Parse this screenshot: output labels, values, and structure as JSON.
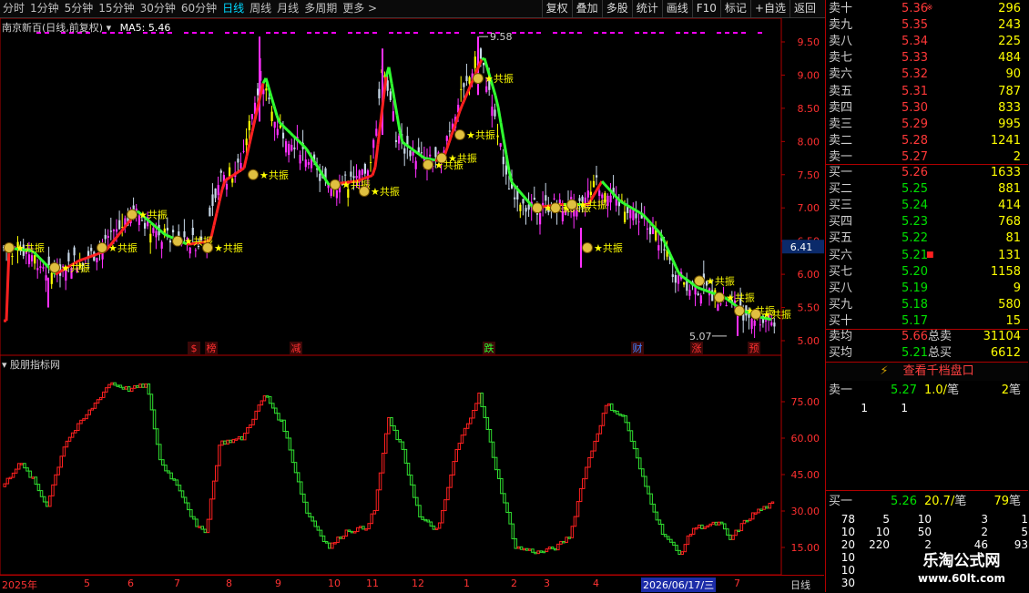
{
  "toolbar": {
    "periods": [
      "分时",
      "1分钟",
      "5分钟",
      "15分钟",
      "30分钟",
      "60分钟",
      "日线",
      "周线",
      "月线",
      "多周期",
      "更多 >"
    ],
    "active_period": "日线",
    "actions": [
      "复权",
      "叠加",
      "多股",
      "统计",
      "画线",
      "F10",
      "标记",
      "+自选",
      "返回"
    ]
  },
  "chart": {
    "title": "南京新百(日线,前复权)",
    "ma_label": "MA5: 5.46",
    "price_axis": [
      "9.50",
      "9.00",
      "8.50",
      "8.00",
      "7.50",
      "7.00",
      "6.50",
      "6.00",
      "5.50",
      "5.00"
    ],
    "current_price_tag": "6.41",
    "high_label": "9.58",
    "low_label": "5.07",
    "signal_label": "共振",
    "event_markers": [
      "$",
      "榜",
      "减",
      "跌",
      "财",
      "涨",
      "预"
    ],
    "indicator_title": "股朋指标网",
    "indicator_axis": [
      "75.00",
      "60.00",
      "45.00",
      "30.00",
      "15.00"
    ],
    "x_labels": [
      "2025年",
      "5",
      "6",
      "7",
      "8",
      "9",
      "10",
      "11",
      "12",
      "1",
      "2",
      "3",
      "4",
      "2026/06/17/三",
      "7"
    ],
    "period_label": "日线"
  },
  "quote": {
    "sell": [
      {
        "label": "卖十",
        "price": "5.36",
        "vol": "296",
        "mark": "※"
      },
      {
        "label": "卖九",
        "price": "5.35",
        "vol": "243",
        "mark": ""
      },
      {
        "label": "卖八",
        "price": "5.34",
        "vol": "225",
        "mark": ""
      },
      {
        "label": "卖七",
        "price": "5.33",
        "vol": "484",
        "mark": ""
      },
      {
        "label": "卖六",
        "price": "5.32",
        "vol": "90",
        "mark": ""
      },
      {
        "label": "卖五",
        "price": "5.31",
        "vol": "787",
        "mark": ""
      },
      {
        "label": "卖四",
        "price": "5.30",
        "vol": "833",
        "mark": ""
      },
      {
        "label": "卖三",
        "price": "5.29",
        "vol": "995",
        "mark": ""
      },
      {
        "label": "卖二",
        "price": "5.28",
        "vol": "1241",
        "mark": ""
      },
      {
        "label": "卖一",
        "price": "5.27",
        "vol": "2",
        "mark": ""
      }
    ],
    "buy": [
      {
        "label": "买一",
        "price": "5.26",
        "vol": "1633",
        "mark": ""
      },
      {
        "label": "买二",
        "price": "5.25",
        "vol": "881",
        "mark": ""
      },
      {
        "label": "买三",
        "price": "5.24",
        "vol": "414",
        "mark": ""
      },
      {
        "label": "买四",
        "price": "5.23",
        "vol": "768",
        "mark": ""
      },
      {
        "label": "买五",
        "price": "5.22",
        "vol": "81",
        "mark": ""
      },
      {
        "label": "买六",
        "price": "5.21",
        "vol": "131",
        "mark": "■"
      },
      {
        "label": "买七",
        "price": "5.20",
        "vol": "1158",
        "mark": ""
      },
      {
        "label": "买八",
        "price": "5.19",
        "vol": "9",
        "mark": ""
      },
      {
        "label": "买九",
        "price": "5.18",
        "vol": "580",
        "mark": ""
      },
      {
        "label": "买十",
        "price": "5.17",
        "vol": "15",
        "mark": ""
      }
    ],
    "avg_sell": {
      "label": "卖均",
      "price": "5.66",
      "label2": "总卖",
      "vol": "31104"
    },
    "avg_buy": {
      "label": "买均",
      "price": "5.21",
      "label2": "总买",
      "vol": "6612"
    },
    "detail_button": "查看千档盘口",
    "ask1": {
      "label": "卖一",
      "price": "5.27",
      "amount": "1.0/",
      "unit": "笔",
      "count": "2",
      "unit2": "笔"
    },
    "ask1_queue": [
      "1",
      "1"
    ],
    "bid1": {
      "label": "买一",
      "price": "5.26",
      "amount": "20.7/",
      "unit": "笔",
      "count": "79",
      "unit2": "笔"
    },
    "bid1_queue": [
      [
        "78",
        "5",
        "10",
        "3",
        "1"
      ],
      [
        "10",
        "10",
        "50",
        "2",
        "5"
      ],
      [
        "20",
        "220",
        "2",
        "46",
        "93"
      ],
      [
        "10",
        "",
        "",
        "",
        ""
      ],
      [
        "10",
        "",
        "",
        "",
        ""
      ],
      [
        "30",
        "",
        "",
        "",
        ""
      ]
    ],
    "watermark_line1": "乐淘公式网",
    "watermark_line2": "www.60lt.com"
  }
}
